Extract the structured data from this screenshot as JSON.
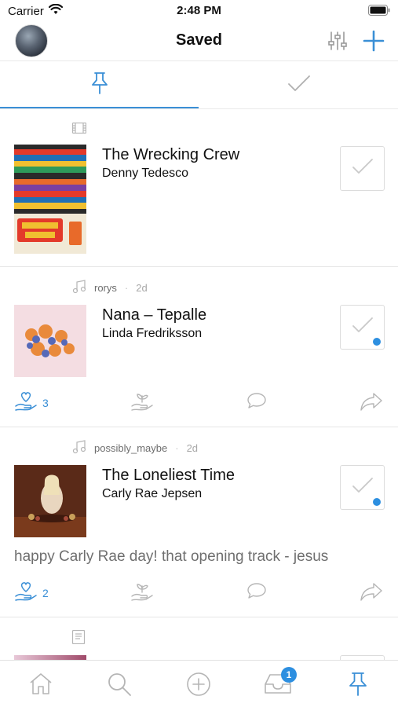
{
  "status_bar": {
    "carrier": "Carrier",
    "time": "2:48 PM"
  },
  "nav": {
    "title": "Saved"
  },
  "colors": {
    "accent": "#3a8fd6",
    "badge": "#2d8fe0",
    "muted_icon": "#b5b5b5"
  },
  "tabs": [
    {
      "icon": "pin-icon",
      "active": true
    },
    {
      "icon": "check-icon",
      "active": false
    }
  ],
  "items": [
    {
      "type_icon": "film-icon",
      "user": "",
      "age": "",
      "title": "The Wrecking Crew",
      "artist": "Denny Tedesco",
      "has_spotify": false
    },
    {
      "type_icon": "music-note-icon",
      "user": "rorys",
      "dot": "·",
      "age": "2d",
      "title": "Nana – Tepalle",
      "artist": "Linda Fredriksson",
      "has_spotify": true,
      "like_count": "3"
    },
    {
      "type_icon": "music-note-icon",
      "user": "possibly_maybe",
      "dot": "·",
      "age": "2d",
      "title": "The Loneliest Time",
      "artist": "Carly Rae Jepsen",
      "comment": "happy Carly Rae day! that opening track - jesus",
      "has_spotify": true,
      "like_count": "2"
    },
    {
      "type_icon": "book-icon"
    }
  ],
  "tab_bar": {
    "items": [
      "home-icon",
      "search-icon",
      "add-circle-icon",
      "inbox-icon",
      "pin-icon"
    ],
    "inbox_badge": "1"
  }
}
